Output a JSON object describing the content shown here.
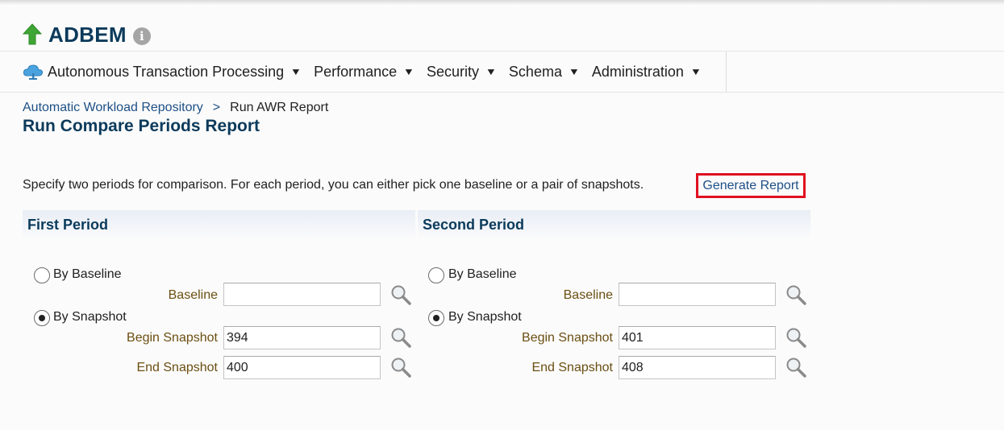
{
  "app": {
    "title": "ADBEM",
    "info_icon": "info-icon",
    "status_icon": "up-arrow-icon",
    "status_color": "#3fa535"
  },
  "menu": [
    {
      "label": "Autonomous Transaction Processing",
      "icon": "cloud-icon"
    },
    {
      "label": "Performance"
    },
    {
      "label": "Security"
    },
    {
      "label": "Schema"
    },
    {
      "label": "Administration"
    }
  ],
  "breadcrumb": {
    "parent": "Automatic Workload Repository",
    "separator": ">",
    "current": "Run AWR Report"
  },
  "page_title": "Run Compare Periods Report",
  "instructions": "Specify two periods for comparison. For each period, you can either pick one baseline or a pair of snapshots.",
  "generate_button": "Generate Report",
  "highlight_color": "#e0101f",
  "periods": [
    {
      "heading": "First Period",
      "by_baseline_label": "By Baseline",
      "by_snapshot_label": "By Snapshot",
      "selected": "By Snapshot",
      "baseline_label": "Baseline",
      "baseline_value": "",
      "begin_label": "Begin Snapshot",
      "begin_value": "394",
      "end_label": "End Snapshot",
      "end_value": "400"
    },
    {
      "heading": "Second Period",
      "by_baseline_label": "By Baseline",
      "by_snapshot_label": "By Snapshot",
      "selected": "By Snapshot",
      "baseline_label": "Baseline",
      "baseline_value": "",
      "begin_label": "Begin Snapshot",
      "begin_value": "401",
      "end_label": "End Snapshot",
      "end_value": "408"
    }
  ]
}
